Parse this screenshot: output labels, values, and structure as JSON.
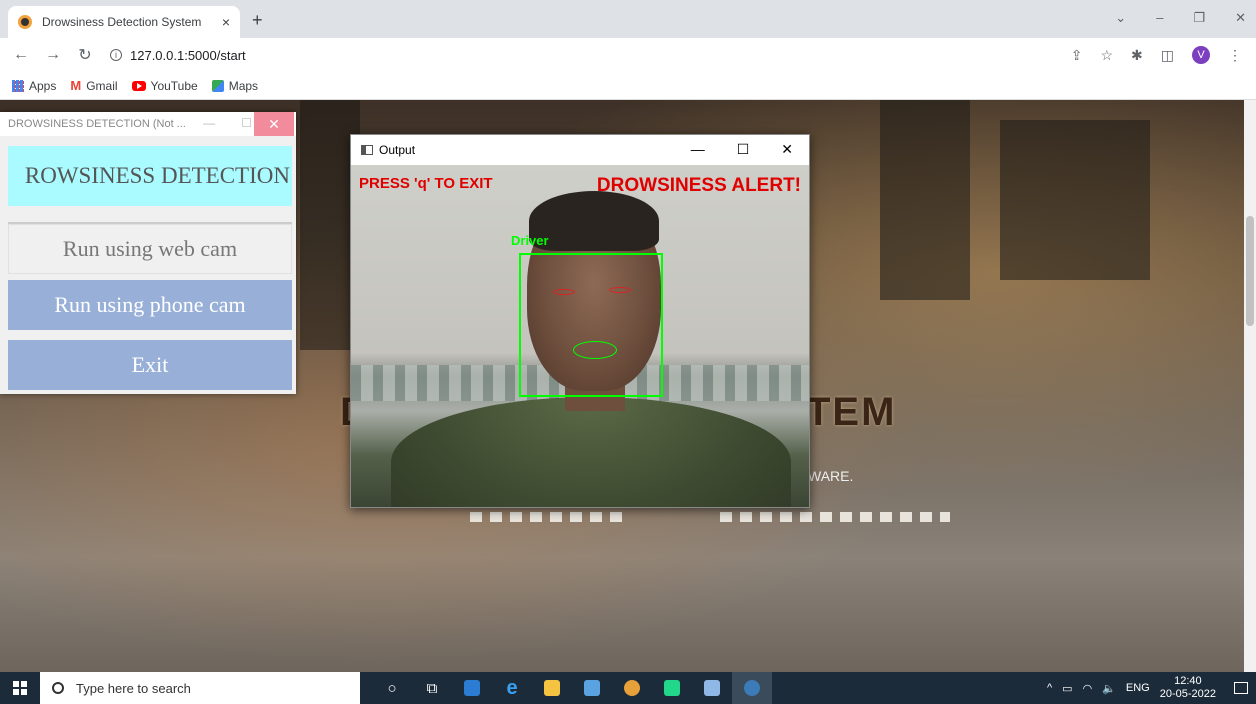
{
  "browser": {
    "tab_title": "Drowsiness Detection System",
    "tab_close": "×",
    "new_tab": "+",
    "url": "127.0.0.1:5000/start",
    "avatar_letter": "V",
    "bookmarks": [
      "Apps",
      "Gmail",
      "YouTube",
      "Maps"
    ]
  },
  "page": {
    "title_left": "D",
    "title_right": "TEM",
    "subtitle_fragment": "WARE."
  },
  "tk_window": {
    "title": "DROWSINESS DETECTION (Not ...",
    "heading": "ROWSINESS DETECTION",
    "btn_webcam": "Run using web cam",
    "btn_phonecam": "Run using phone cam",
    "btn_exit": "Exit"
  },
  "cv_window": {
    "title": "Output",
    "press_q": "PRESS 'q' TO EXIT",
    "alert": "DROWSINESS ALERT!",
    "face_label": "Driver"
  },
  "taskbar": {
    "search_placeholder": "Type here to search",
    "lang": "ENG",
    "time": "12:40",
    "date": "20-05-2022"
  },
  "colors": {
    "alert_red": "#e00000",
    "detect_green": "#00ff00",
    "tk_heading_bg": "#a9fbff",
    "tk_button_bg": "#98b0d8"
  }
}
